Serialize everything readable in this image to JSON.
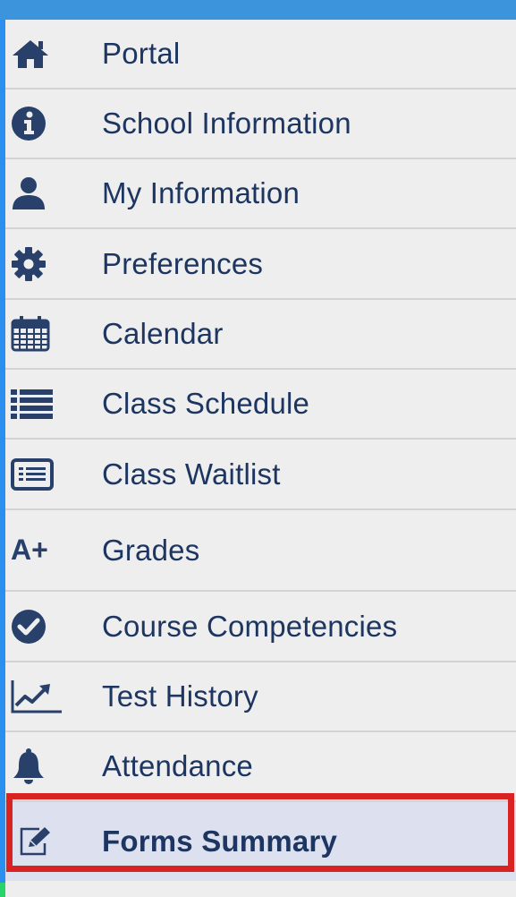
{
  "menu": {
    "items": [
      {
        "label": "Portal",
        "icon": "home-icon"
      },
      {
        "label": "School Information",
        "icon": "info-circle-icon"
      },
      {
        "label": "My Information",
        "icon": "user-icon"
      },
      {
        "label": "Preferences",
        "icon": "gear-icon"
      },
      {
        "label": "Calendar",
        "icon": "calendar-icon"
      },
      {
        "label": "Class Schedule",
        "icon": "list-icon"
      },
      {
        "label": "Class Waitlist",
        "icon": "list-card-icon"
      },
      {
        "label": "Grades",
        "icon": "a-plus-icon",
        "icon_text": "A+"
      },
      {
        "label": "Course Competencies",
        "icon": "check-circle-icon"
      },
      {
        "label": "Test History",
        "icon": "line-chart-icon"
      },
      {
        "label": "Attendance",
        "icon": "bell-icon"
      },
      {
        "label": "Forms Summary",
        "icon": "edit-icon",
        "selected": true
      }
    ]
  },
  "colors": {
    "text": "#1d3561",
    "icon": "#28406a",
    "background": "#eeeeee",
    "selected_background": "#dde0ef",
    "highlight_border": "#d92222",
    "top_bar": "#3c95dc"
  }
}
